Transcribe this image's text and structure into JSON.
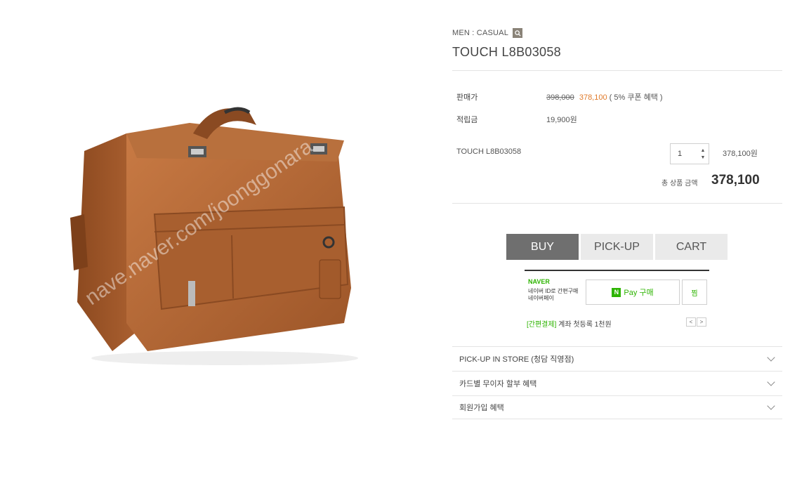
{
  "product": {
    "category": "MEN : CASUAL",
    "title": "TOUCH L8B03058",
    "image_watermark": "nave.naver.com/joonggonara"
  },
  "pricing": {
    "price_label": "판매가",
    "original_price": "398,000",
    "sale_price": "378,100",
    "coupon_note": "( 5% 쿠폰 혜택 )",
    "points_label": "적립금",
    "points_value": "19,900원"
  },
  "option": {
    "name": "TOUCH L8B03058",
    "quantity": "1",
    "price": "378,100원"
  },
  "total": {
    "label": "총 상품 금액",
    "value": "378,100"
  },
  "actions": {
    "buy": "BUY",
    "pickup": "PICK-UP",
    "cart": "CART"
  },
  "naver": {
    "brand": "NAVER",
    "desc_line1": "네이버 ID로 간편구매",
    "desc_line2": "네이버페이",
    "pay_n": "N",
    "pay_label": "Pay 구매",
    "wish_label": "찜",
    "promo_tag": "[간편결제]",
    "promo_text": "계좌 첫등록 1천원",
    "prev": "<",
    "next": ">"
  },
  "accordion": [
    {
      "label": "PICK-UP IN STORE (청담 직영점)"
    },
    {
      "label": "카드별 무이자 할부 혜택"
    },
    {
      "label": "회원가입 혜택"
    }
  ],
  "colors": {
    "bag": "#b86a35",
    "sale": "#e07a2a",
    "naver_green": "#2db400",
    "buy_button": "#6f6f6f"
  }
}
